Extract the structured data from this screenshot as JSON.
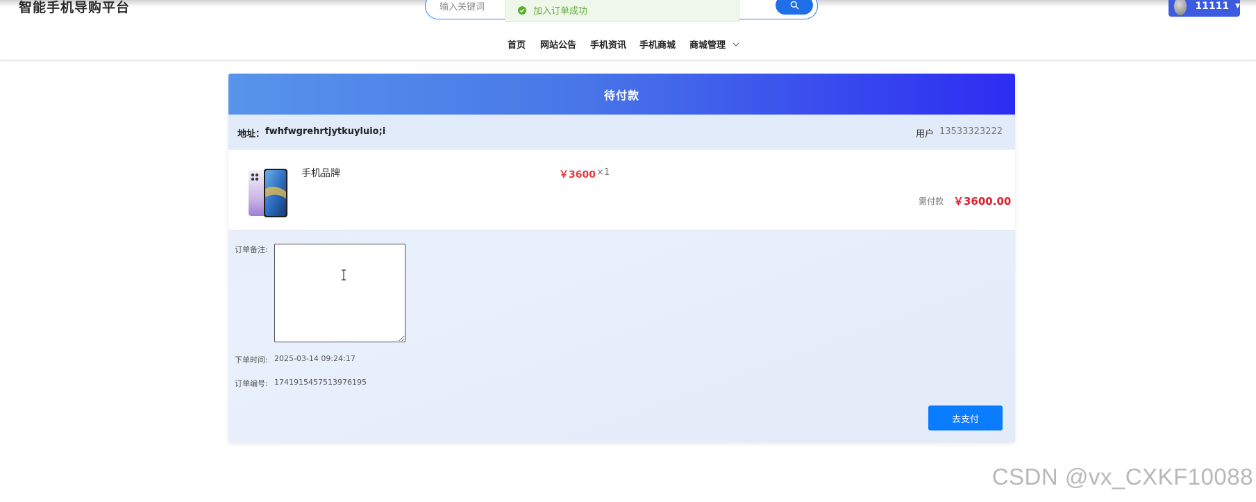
{
  "header": {
    "site_title": "智能手机导购平台",
    "search_placeholder": "输入关键词",
    "toast_message": "加入订单成功",
    "username": "11111"
  },
  "nav": {
    "items": [
      {
        "label": "首页"
      },
      {
        "label": "网站公告"
      },
      {
        "label": "手机资讯"
      },
      {
        "label": "手机商城"
      },
      {
        "label": "商城管理"
      }
    ]
  },
  "order": {
    "status_title": "待付款",
    "address_label": "地址：",
    "address_value": "fwhfwgrehrtjytkuyluio;i",
    "user_label": "用户",
    "user_phone": "13533323222",
    "item": {
      "name": "手机品牌",
      "price": "￥3600",
      "quantity": "×1"
    },
    "due_label": "需付款",
    "due_amount": "￥3600.00",
    "note_label": "订单备注:",
    "note_value": "",
    "order_time_label": "下单时间:",
    "order_time_value": "2025-03-14 09:24:17",
    "order_no_label": "订单编号:",
    "order_no_value": "1741915457513976195",
    "pay_button_label": "去支付"
  },
  "watermark": "CSDN @vx_CXKF10088",
  "colors": {
    "header_gradient_start": "#5794ea",
    "header_gradient_end": "#2d2cf2",
    "price_red": "#e01d2c",
    "pay_button_blue": "#0a7cff",
    "toast_green": "#52b228"
  }
}
